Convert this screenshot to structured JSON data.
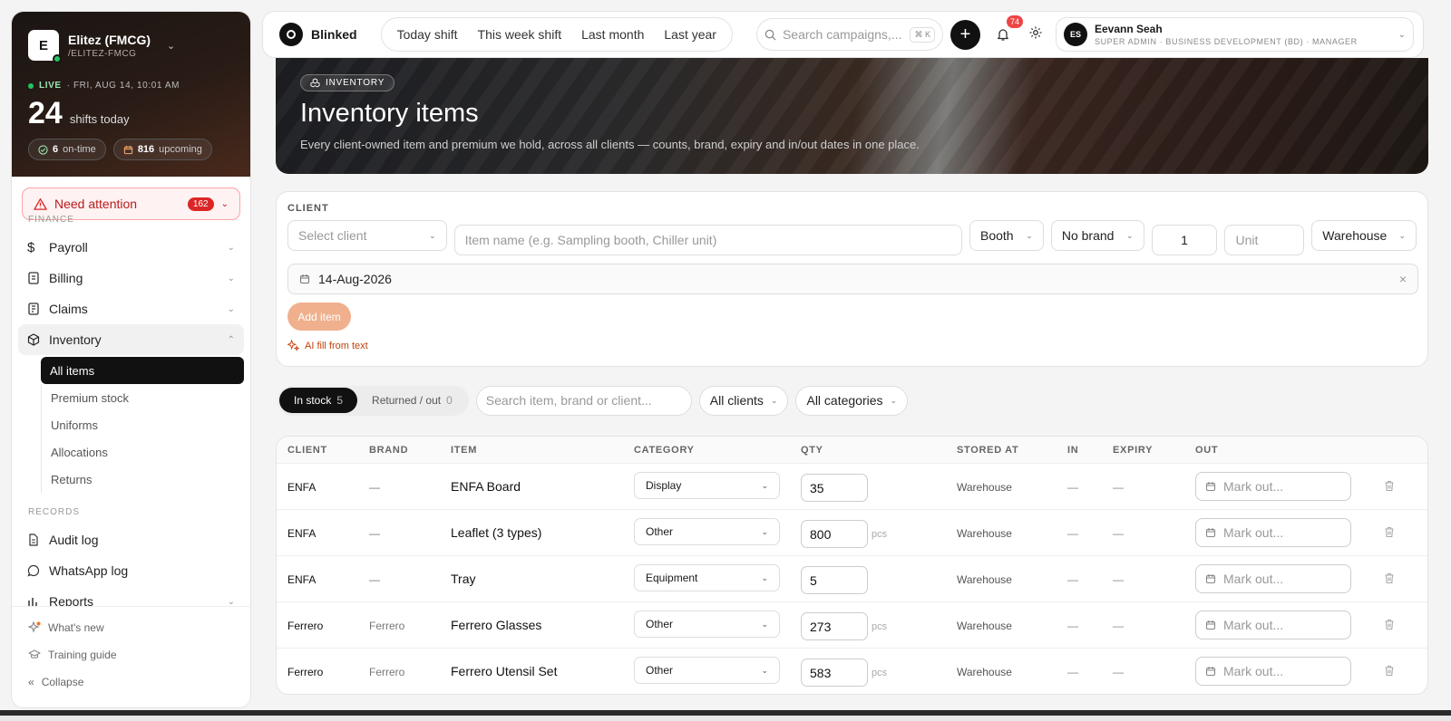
{
  "sidebar": {
    "org_logo_letter": "E",
    "org_name": "Elitez (FMCG)",
    "org_slug": "/ELITEZ-FMCG",
    "live_label": "LIVE",
    "live_date": "· FRI, AUG 14, 10:01 AM",
    "shifts_count": "24",
    "shifts_label": "shifts today",
    "ontime_count": "6",
    "ontime_label": "on-time",
    "upcoming_count": "816",
    "upcoming_label": "upcoming",
    "attention_label": "Need attention",
    "attention_count": "162",
    "finance_section": "FINANCE",
    "records_section": "RECORDS",
    "items": {
      "payroll": "Payroll",
      "billing": "Billing",
      "claims": "Claims",
      "inventory": "Inventory",
      "audit_log": "Audit log",
      "whatsapp_log": "WhatsApp log",
      "reports": "Reports"
    },
    "inventory_sub": [
      "All items",
      "Premium stock",
      "Uniforms",
      "Allocations",
      "Returns"
    ],
    "footer": {
      "whats_new": "What's new",
      "training": "Training guide",
      "collapse": "Collapse"
    }
  },
  "topbar": {
    "brand": "Blinked",
    "segments": [
      "Today shift",
      "This week shift",
      "Last month",
      "Last year"
    ],
    "search_placeholder": "Search campaigns,...",
    "search_kbd": "⌘ K",
    "notif_count": "74",
    "user_initials": "ES",
    "user_name": "Eevann Seah",
    "user_role": "SUPER ADMIN · BUSINESS DEVELOPMENT (BD) · MANAGER"
  },
  "hero": {
    "badge": "INVENTORY",
    "title": "Inventory items",
    "subtitle": "Every client-owned item and premium we hold, across all clients — counts, brand, expiry and in/out dates in one place."
  },
  "form": {
    "label": "CLIENT",
    "client_placeholder": "Select client",
    "item_placeholder": "Item name (e.g. Sampling booth, Chiller unit)",
    "category_value": "Booth",
    "brand_value": "No brand",
    "qty_value": "1",
    "unit_placeholder": "Unit",
    "location_value": "Warehouse",
    "date_value": "14-Aug-2026",
    "add_label": "Add item",
    "ai_fill_label": "AI fill from text"
  },
  "filters": {
    "in_stock_label": "In stock",
    "in_stock_count": "5",
    "returned_label": "Returned / out",
    "returned_count": "0",
    "search_placeholder": "Search item, brand or client...",
    "clients_value": "All clients",
    "categories_value": "All categories"
  },
  "table": {
    "headers": {
      "client": "CLIENT",
      "brand": "BRAND",
      "item": "ITEM",
      "category": "CATEGORY",
      "qty": "QTY",
      "stored_at": "STORED AT",
      "in": "IN",
      "expiry": "EXPIRY",
      "out": "OUT"
    },
    "out_placeholder": "Mark out...",
    "rows": [
      {
        "client": "ENFA",
        "brand": "—",
        "item": "ENFA Board",
        "category": "Display",
        "qty": "35",
        "unit": "",
        "stored_at": "Warehouse",
        "in": "—",
        "expiry": "—"
      },
      {
        "client": "ENFA",
        "brand": "—",
        "item": "Leaflet (3 types)",
        "category": "Other",
        "qty": "800",
        "unit": "pcs",
        "stored_at": "Warehouse",
        "in": "—",
        "expiry": "—"
      },
      {
        "client": "ENFA",
        "brand": "—",
        "item": "Tray",
        "category": "Equipment",
        "qty": "5",
        "unit": "",
        "stored_at": "Warehouse",
        "in": "—",
        "expiry": "—"
      },
      {
        "client": "Ferrero",
        "brand": "Ferrero",
        "item": "Ferrero Glasses",
        "category": "Other",
        "qty": "273",
        "unit": "pcs",
        "stored_at": "Warehouse",
        "in": "—",
        "expiry": "—"
      },
      {
        "client": "Ferrero",
        "brand": "Ferrero",
        "item": "Ferrero Utensil Set",
        "category": "Other",
        "qty": "583",
        "unit": "pcs",
        "stored_at": "Warehouse",
        "in": "—",
        "expiry": "—"
      }
    ]
  },
  "colors": {
    "accent": "#111111",
    "danger": "#dc2626",
    "add_button": "#f0b08d",
    "ai_fill": "#c2410c",
    "live": "#22c55e"
  }
}
